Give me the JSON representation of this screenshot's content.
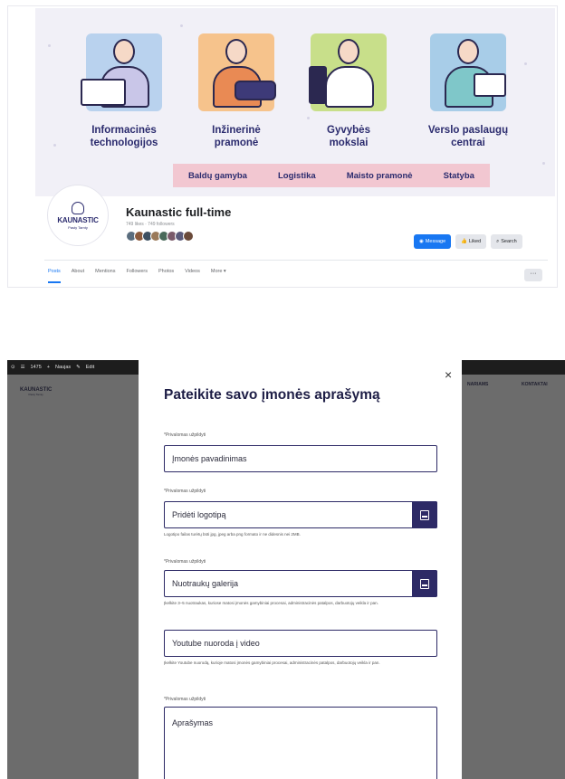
{
  "cover": {
    "categories": [
      {
        "line1": "Informacinės",
        "line2": "technologijos"
      },
      {
        "line1": "Inžinerinė",
        "line2": "pramonė"
      },
      {
        "line1": "Gyvybės",
        "line2": "mokslai"
      },
      {
        "line1": "Verslo paslaugų",
        "line2": "centrai"
      }
    ],
    "ribbon": [
      "Baldų gamyba",
      "Logistika",
      "Maisto pramonė",
      "Statyba"
    ],
    "illustration_colors": [
      "#b9d2ee",
      "#f6c38c",
      "#c8df8a",
      "#a8cde8"
    ]
  },
  "page": {
    "logo_text": "KAUNASTIC",
    "logo_sub": "Pasty Tamty",
    "name": "Kaunastic full-time",
    "meta": "749 likes · 749 followers",
    "friend_colors": [
      "#5a6d7e",
      "#8b5a3c",
      "#3d4f61",
      "#9a7a5a",
      "#4a6a5a",
      "#7a5a6a",
      "#5a5a7a",
      "#6a4a3a"
    ],
    "buttons": {
      "message": "Message",
      "liked": "Liked",
      "search": "Search"
    },
    "tabs": [
      "Posts",
      "About",
      "Mentions",
      "Followers",
      "Photos",
      "Videos",
      "More ▾"
    ],
    "more_dots": "···",
    "accent": "#1877f2"
  },
  "site": {
    "admin_bar": [
      "⊙",
      "☰",
      "1475",
      "+",
      "Naujas",
      "✎",
      "Edit"
    ],
    "logo_text": "KAUNASTIC",
    "logo_sub": "Pasty Tamty",
    "nav": [
      "NARIAMS",
      "KONTAKTAI"
    ]
  },
  "modal": {
    "close": "×",
    "title": "Pateikite savo įmonės aprašymą",
    "required_label": "*Privalomas užpildyti",
    "company_name_placeholder": "Įmonės pavadinimas",
    "logo_placeholder": "Pridėti logotipą",
    "logo_hint": "Logotipo failas turėtų būti jpg, jpeg arba png formato ir ne didesnis nei 2MB.",
    "gallery_placeholder": "Nuotraukų galerija",
    "gallery_hint": "Įkelkite 3–5 nuotraukas, kuriose matosi įmonės gamybiniai procesai, administracinės patalpos, darbuotojų veikla ir pan.",
    "youtube_placeholder": "Youtube nuoroda į video",
    "youtube_hint": "Įkelkite Youtube nuorodą, kurioje matosi įmonės gamybiniai procesai, administracinės patalpos, darbuotojų veikla ir pan.",
    "description_placeholder": "Aprašymas",
    "brand_color": "#2d2a66"
  }
}
